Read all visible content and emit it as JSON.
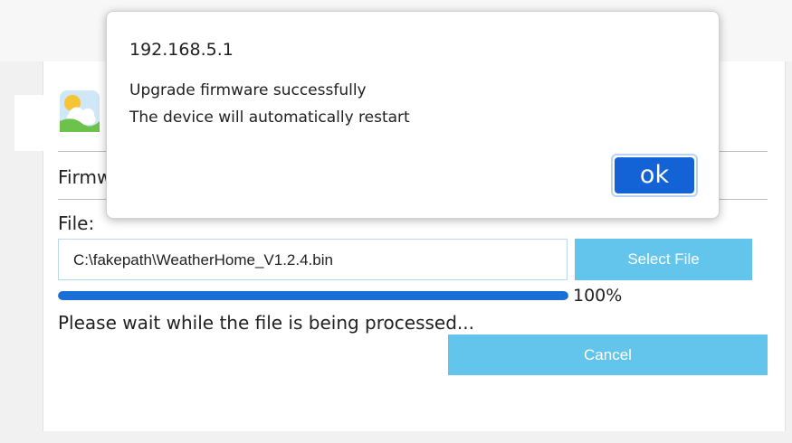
{
  "page": {
    "firmware_heading": "Firmw",
    "file_label": "File:",
    "file_path_value": "C:\\fakepath\\WeatherHome_V1.2.4.bin",
    "select_file_label": "Select File",
    "progress_percent": 100,
    "progress_text": "100%",
    "status_text": "Please wait while the file is being processed...",
    "cancel_label": "Cancel"
  },
  "alert": {
    "origin": "192.168.5.1",
    "message_line1": "Upgrade firmware successfully",
    "message_line2": "The device will automatically restart",
    "ok_label": "ok"
  },
  "icons": {
    "app_logo": "weather-app-logo-icon"
  },
  "colors": {
    "button_light_blue": "#63c5ec",
    "progress_blue": "#1a6fd6",
    "ok_blue": "#1463d6"
  }
}
